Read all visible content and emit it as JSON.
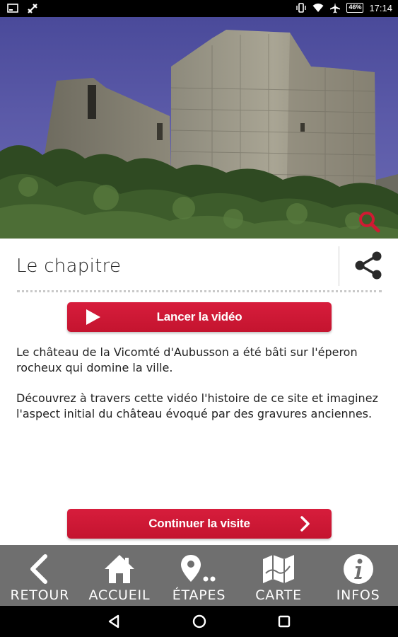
{
  "status_bar": {
    "time": "17:14",
    "battery": "46%",
    "icons": [
      "screenshot-icon",
      "tools-icon",
      "vibrate-icon",
      "wifi-icon",
      "airplane-icon",
      "battery-icon"
    ]
  },
  "hero": {
    "image": "castle-ruins-photo",
    "zoom_icon": "magnifier-icon"
  },
  "header": {
    "title": "Le chapitre",
    "share_icon": "share-icon"
  },
  "actions": {
    "video_label": "Lancer la vidéo",
    "continue_label": "Continuer la visite"
  },
  "content": {
    "paragraph_1": "Le château de la Vicomté d'Aubusson a été bâti sur l'éperon rocheux qui domine la ville.",
    "paragraph_2": "Découvrez à travers cette vidéo l'histoire de ce site et imaginez l'aspect initial du château évoqué par des gravures anciennes."
  },
  "bottom_nav": {
    "items": [
      {
        "label": "RETOUR",
        "icon": "chevron-left-icon"
      },
      {
        "label": "ACCUEIL",
        "icon": "home-icon"
      },
      {
        "label": "ÉTAPES",
        "icon": "location-pin-icon"
      },
      {
        "label": "CARTE",
        "icon": "map-icon"
      },
      {
        "label": "INFOS",
        "icon": "info-icon"
      }
    ]
  },
  "colors": {
    "accent": "#c8102e",
    "nav_background": "#6f6f6f",
    "status_background": "#000000"
  }
}
